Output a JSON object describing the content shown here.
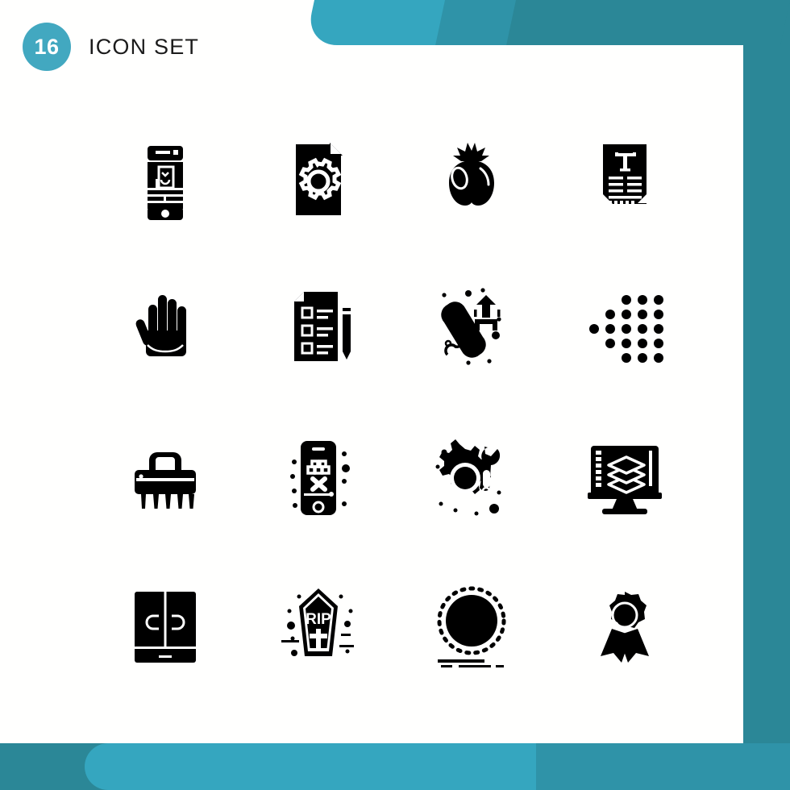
{
  "header": {
    "badge_count": "16",
    "title": "Icon Set"
  },
  "theme": {
    "teal_light": "#35a6bf",
    "teal_mid": "#2f93a8",
    "teal_dark": "#2b8797",
    "badge_fill": "#42a8c0",
    "icon_color": "#000000",
    "card_background": "#ffffff"
  },
  "grid": {
    "columns": 4,
    "rows": 4,
    "total": 16,
    "icons": [
      {
        "index": 1,
        "name": "mobile-layout-icon",
        "label": "Mobile App Layout"
      },
      {
        "index": 2,
        "name": "file-settings-gear-icon",
        "label": "File Settings"
      },
      {
        "index": 3,
        "name": "tomato-icon",
        "label": "Tomato"
      },
      {
        "index": 4,
        "name": "typography-document-icon",
        "label": "Typography Document"
      },
      {
        "index": 5,
        "name": "hand-palm-icon",
        "label": "Hand"
      },
      {
        "index": 6,
        "name": "checklist-pencil-icon",
        "label": "Checklist"
      },
      {
        "index": 7,
        "name": "phone-upload-icon",
        "label": "Call Upload"
      },
      {
        "index": 8,
        "name": "dotted-arrow-icon",
        "label": "Dotted Arrow"
      },
      {
        "index": 9,
        "name": "scrub-brush-icon",
        "label": "Scrub Brush"
      },
      {
        "index": 10,
        "name": "mobile-game-icon",
        "label": "Mobile Game"
      },
      {
        "index": 11,
        "name": "gear-wrench-icon",
        "label": "Maintenance"
      },
      {
        "index": 12,
        "name": "monitor-layers-icon",
        "label": "Monitor Layers"
      },
      {
        "index": 13,
        "name": "wardrobe-icon",
        "label": "Wardrobe"
      },
      {
        "index": 14,
        "name": "coffin-rip-icon",
        "label": "Coffin"
      },
      {
        "index": 15,
        "name": "dotted-circle-ball-icon",
        "label": "Ball"
      },
      {
        "index": 16,
        "name": "award-ribbon-icon",
        "label": "Award Badge"
      }
    ],
    "icon_texts": {
      "typography_letter": "T",
      "coffin_text": "RIP"
    }
  }
}
